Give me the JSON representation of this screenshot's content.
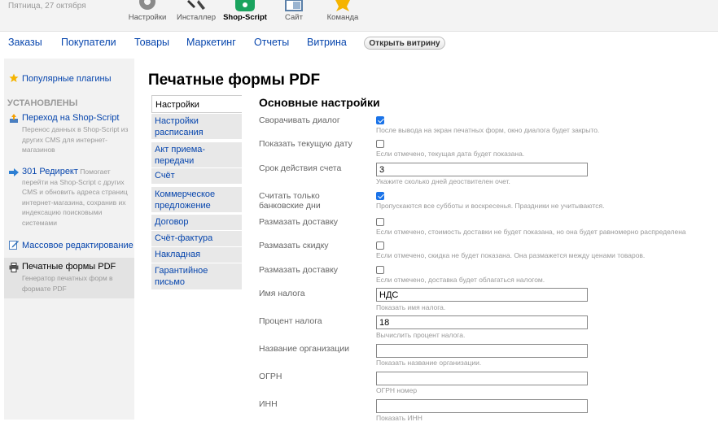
{
  "header": {
    "date": "Пятница, 27 октября",
    "apps": [
      {
        "label": "Настройки",
        "icon": "gear-icon",
        "color": "#8a8a8a"
      },
      {
        "label": "Инсталлер",
        "icon": "installer-icon",
        "color": "#4a4a4a"
      },
      {
        "label": "Shop-Script",
        "icon": "shop-script-icon",
        "color": "#1aa35e"
      },
      {
        "label": "Сайт",
        "icon": "site-icon",
        "color": "#5a7fa8"
      },
      {
        "label": "Команда",
        "icon": "star-icon",
        "color": "#f5b400"
      }
    ]
  },
  "nav": {
    "items": [
      "Заказы",
      "Покупатели",
      "Товары",
      "Маркетинг",
      "Отчеты",
      "Витрина"
    ],
    "open_store": "Открыть витрину"
  },
  "sidebar": {
    "popular": "Популярные плагины",
    "installed_heading": "УСТАНОВЛЕНЫ",
    "plugins": [
      {
        "title": "Переход на Shop-Script",
        "desc": "Перенос данных в Shop-Script из других CMS для интернет-магазинов",
        "icon": "import-icon"
      },
      {
        "title": "301 Редирект",
        "desc": "Помогает перейти на Shop-Script с других CMS и обновить адреса страниц интернет-магазина, сохранив их индексацию поисковыми системами",
        "icon": "redirect-arrow-icon"
      },
      {
        "title": "Массовое редактирование",
        "desc": "",
        "icon": "edit-icon"
      },
      {
        "title": "Печатные формы PDF",
        "desc": "Генератор печатных форм в формате PDF",
        "icon": "printer-icon"
      }
    ]
  },
  "main": {
    "title": "Печатные формы PDF",
    "tabs": [
      "Настройки",
      "Настройки расписания",
      "Акт приема-передачи",
      "Счёт",
      "Коммерческое предложение",
      "Договор",
      "Счёт-фактура",
      "Накладная",
      "Гарантийное письмо"
    ],
    "section_title": "Основные настройки",
    "fields": [
      {
        "label": "Сворачивать диалог",
        "type": "checkbox",
        "checked": true,
        "hint": "После вывода на экран печатных форм, окно диалога будет закрыто."
      },
      {
        "label": "Показать текущую дату",
        "type": "checkbox",
        "checked": false,
        "hint": "Если отмечено, текущая дата будет показана."
      },
      {
        "label": "Срок действия счета",
        "type": "text",
        "value": "3",
        "hint": "Укажите сколько дней деоствителен очет."
      },
      {
        "label": "Считать только банковские дни",
        "type": "checkbox",
        "checked": true,
        "hint": "Пропускаются все субботы и воскресенья. Праздники не учитываются."
      },
      {
        "label": "Размазать доставку",
        "type": "checkbox",
        "checked": false,
        "hint": "Если отмечено, стоимость доставки не будет показана, но она будет равномерно распределена"
      },
      {
        "label": "Размазать скидку",
        "type": "checkbox",
        "checked": false,
        "hint": "Если отмечено, скидка не будет показана. Она размажется между ценами товаров."
      },
      {
        "label": "Размазать доставку",
        "type": "checkbox",
        "checked": false,
        "hint": "Если отмечено, доставка будет облагаться налогом."
      },
      {
        "label": "Имя налога",
        "type": "text",
        "value": "НДС",
        "hint": "Показать имя налога."
      },
      {
        "label": "Процент налога",
        "type": "text",
        "value": "18",
        "hint": "Вычислить процент налога."
      },
      {
        "label": "Название организации",
        "type": "text",
        "value": "",
        "hint": "Показать название организации."
      },
      {
        "label": "ОГРН",
        "type": "text",
        "value": "",
        "hint": "ОГРН номер"
      },
      {
        "label": "ИНН",
        "type": "text",
        "value": "",
        "hint": "Показать ИНН"
      }
    ]
  }
}
